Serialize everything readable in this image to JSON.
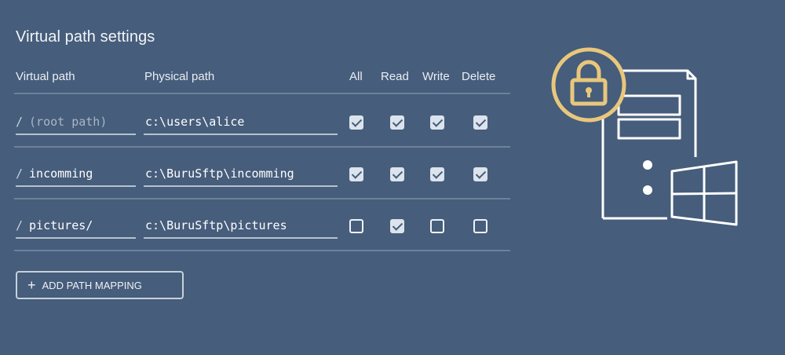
{
  "title": "Virtual path settings",
  "columns": {
    "virtual_path": "Virtual path",
    "physical_path": "Physical path",
    "all": "All",
    "read": "Read",
    "write": "Write",
    "delete": "Delete"
  },
  "rows": [
    {
      "slash": "/",
      "virtual": "",
      "placeholder": "(root path)",
      "physical": "c:\\users\\alice",
      "all": true,
      "read": true,
      "write": true,
      "delete": true
    },
    {
      "slash": "/",
      "virtual": "incomming",
      "placeholder": "",
      "physical": "c:\\BuruSftp\\incomming",
      "all": true,
      "read": true,
      "write": true,
      "delete": true
    },
    {
      "slash": "/",
      "virtual": "pictures/",
      "placeholder": "",
      "physical": "c:\\BuruSftp\\pictures",
      "all": false,
      "read": true,
      "write": false,
      "delete": false
    }
  ],
  "add_button": {
    "icon": "+",
    "label": "ADD PATH MAPPING"
  },
  "colors": {
    "background": "#465d7b",
    "lock_accent": "#e8c77c"
  },
  "icons": [
    "plus-icon",
    "lock-icon",
    "server-icon",
    "windows-logo-icon"
  ]
}
